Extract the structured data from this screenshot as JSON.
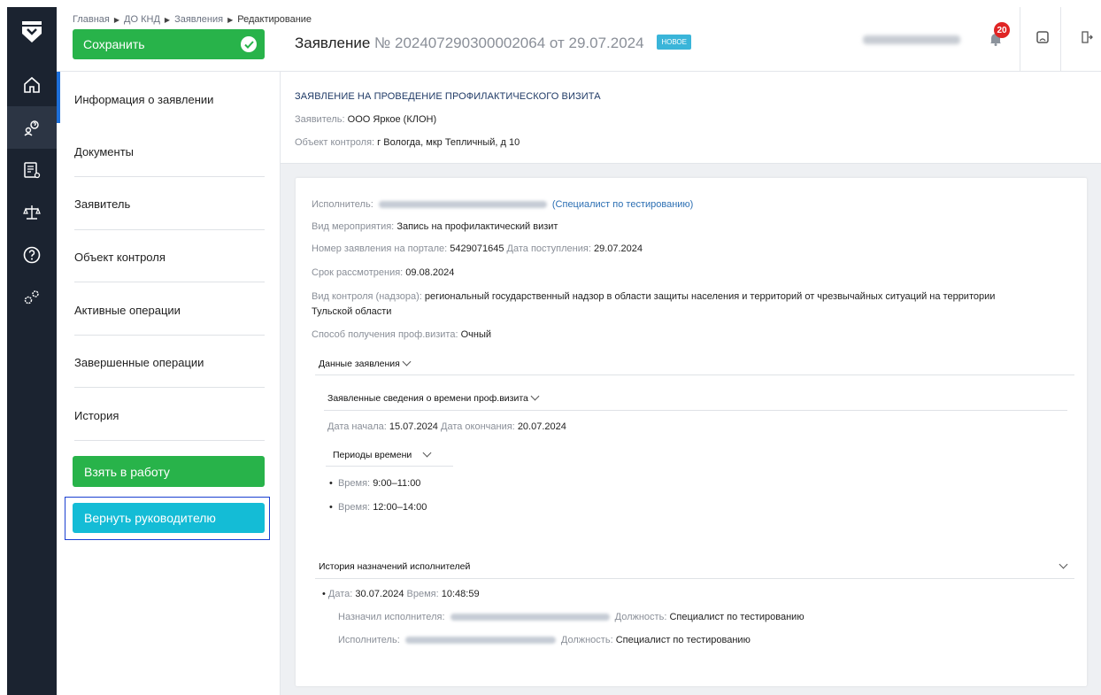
{
  "breadcrumb": [
    "Главная",
    "ДО КНД",
    "Заявления",
    "Редактирование"
  ],
  "header": {
    "save_label": "Сохранить",
    "title_prefix": "Заявление",
    "title_number": "№ 202407290300002064",
    "title_date": "от 29.07.2024",
    "status_badge": "НОВОЕ",
    "notification_count": "20"
  },
  "rail": {
    "items": [
      "home-icon",
      "search-user-icon",
      "document-list-icon",
      "scales-icon",
      "help-icon",
      "settings-icon"
    ]
  },
  "nav": {
    "items": [
      "Информация о заявлении",
      "Документы",
      "Заявитель",
      "Объект контроля",
      "Активные операции",
      "Завершенные операции",
      "История"
    ],
    "take_label": "Взять в работу",
    "return_label": "Вернуть руководителю"
  },
  "summary": {
    "heading": "ЗАЯВЛЕНИЕ НА ПРОВЕДЕНИЕ ПРОФИЛАКТИЧЕСКОГО ВИЗИТА",
    "applicant_label": "Заявитель:",
    "applicant_value": "ООО Яркое (КЛОН)",
    "object_label": "Объект контроля:",
    "object_value": "г Вологда, мкр Тепличный, д 10"
  },
  "details": {
    "executor_label": "Исполнитель:",
    "executor_role": "(Специалист по тестированию)",
    "event_label": "Вид мероприятия:",
    "event_value": "Запись на профилактический визит",
    "portal_label": "Номер заявления на портале:",
    "portal_value": "5429071645",
    "received_label": "Дата поступления:",
    "received_value": "29.07.2024",
    "deadline_label": "Срок рассмотрения:",
    "deadline_value": "09.08.2024",
    "control_label": "Вид контроля (надзора):",
    "control_value_1": "региональный государственный надзор в области защиты населения и территорий от чрезвычайных ситуаций на территории",
    "control_value_2": "Тульской области",
    "method_label": "Способ получения проф.визита:",
    "method_value": "Очный"
  },
  "application_data": {
    "section_label": "Данные заявления",
    "subsection_label": "Заявленные сведения о времени проф.визита",
    "start_label": "Дата начала:",
    "start_value": "15.07.2024",
    "end_label": "Дата окончания:",
    "end_value": "20.07.2024",
    "periods_label": "Периоды времени",
    "time_label": "Время:",
    "periods": [
      "9:00–11:00",
      "12:00–14:00"
    ]
  },
  "history": {
    "section_label": "История назначений исполнителей",
    "date_label": "Дата:",
    "date_value": "30.07.2024",
    "time_label": "Время:",
    "time_value": "10:48:59",
    "assigned_label": "Назначил исполнителя:",
    "position_label": "Должность:",
    "position_value": "Специалист по тестированию",
    "executor_label": "Исполнитель:",
    "position2_value": "Специалист по тестированию"
  },
  "colors": {
    "rail": "#1b2330",
    "green": "#28b34a",
    "cyan": "#14bcd6",
    "badge": "#3ab5d9",
    "alert": "#e02424"
  }
}
